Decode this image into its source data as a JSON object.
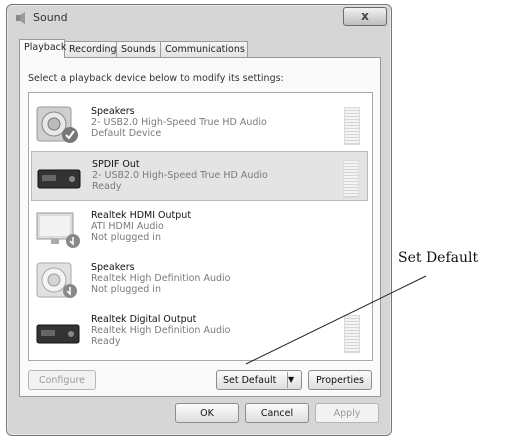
{
  "window": {
    "title": "Sound",
    "close_label": "x"
  },
  "tabs": [
    {
      "label": "Playback",
      "active": true
    },
    {
      "label": "Recording",
      "active": false
    },
    {
      "label": "Sounds",
      "active": false
    },
    {
      "label": "Communications",
      "active": false
    }
  ],
  "instructions": "Select a playback device below to modify its settings:",
  "devices": [
    {
      "name": "Speakers",
      "line2": "2- USB2.0 High-Speed True HD Audio",
      "status": "Default Device",
      "icon": "speaker-default-icon",
      "selected": false
    },
    {
      "name": "SPDIF Out",
      "line2": "2- USB2.0 High-Speed True HD Audio",
      "status": "Ready",
      "icon": "spdif-device-icon",
      "selected": true
    },
    {
      "name": "Realtek HDMI Output",
      "line2": "ATI HDMI Audio",
      "status": "Not plugged in",
      "icon": "hdmi-monitor-icon",
      "selected": false
    },
    {
      "name": "Speakers",
      "line2": "Realtek High Definition Audio",
      "status": "Not plugged in",
      "icon": "speaker-unplugged-icon",
      "selected": false
    },
    {
      "name": "Realtek Digital Output",
      "line2": "Realtek High Definition Audio",
      "status": "Ready",
      "icon": "digital-output-icon",
      "selected": false
    }
  ],
  "buttons": {
    "configure": "Configure",
    "set_default": "Set Default",
    "properties": "Properties",
    "ok": "OK",
    "cancel": "Cancel",
    "apply": "Apply"
  },
  "callout": {
    "label": "Set Default"
  }
}
